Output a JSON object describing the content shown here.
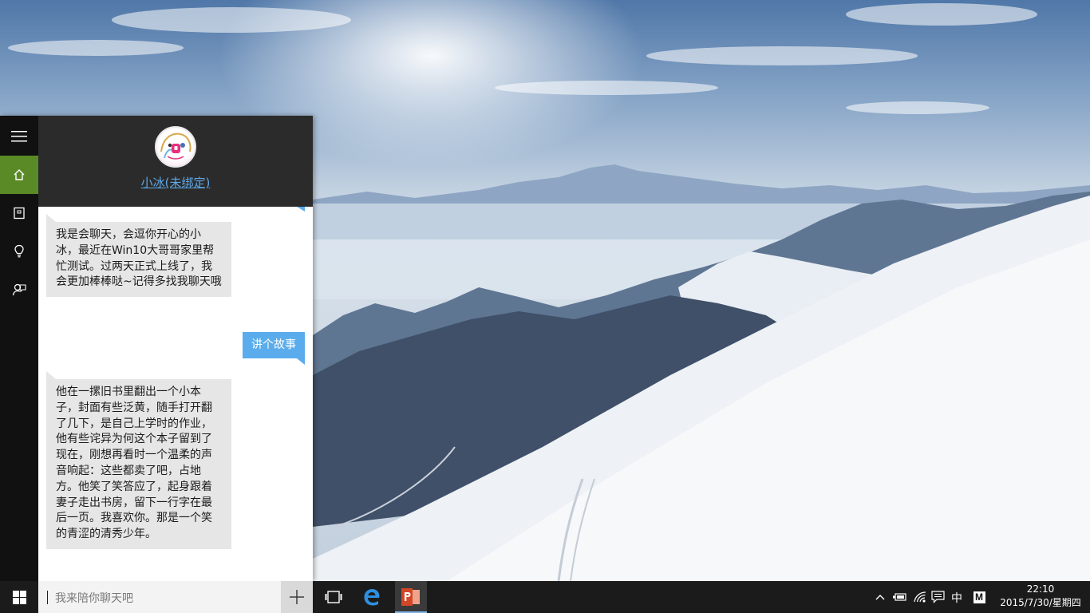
{
  "cortana": {
    "bot_name": "小冰(未绑定)",
    "messages": [
      {
        "from": "bot",
        "text": "我是会聊天，会逗你开心的小冰，最近在Win10大哥哥家里帮忙测试。过两天正式上线了，我会更加棒棒哒~记得多找我聊天哦"
      },
      {
        "from": "user",
        "text": "讲个故事"
      },
      {
        "from": "bot",
        "text": "他在一摞旧书里翻出一个小本子，封面有些泛黄，随手打开翻了几下，是自己上学时的作业，他有些诧异为何这个本子留到了现在，刚想再看时一个温柔的声音响起：这些都卖了吧，占地方。他笑了笑答应了，起身跟着妻子走出书房，留下一行字在最后一页。我喜欢你。那是一个笑的青涩的清秀少年。"
      }
    ],
    "input_placeholder": "我来陪你聊天吧",
    "rail_icons": [
      "hamburger-icon",
      "home-icon",
      "notebook-icon",
      "lightbulb-icon",
      "feedback-icon"
    ]
  },
  "taskbar": {
    "ime_indicator": "中",
    "ime_mode": "M",
    "time": "22:10",
    "date": "2015/7/30/星期四"
  },
  "colors": {
    "accent_green": "#5a8a25",
    "user_bubble": "#5aacec",
    "bot_bubble": "#e6e6e6",
    "link_blue": "#5ea8e8"
  }
}
